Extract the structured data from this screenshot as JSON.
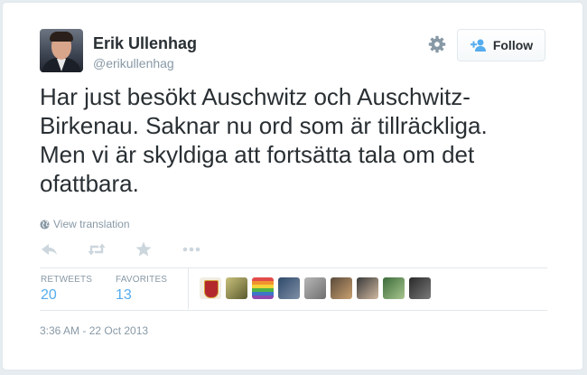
{
  "author": {
    "name": "Erik Ullenhag",
    "handle": "@erikullenhag"
  },
  "follow_button": {
    "label": "Follow"
  },
  "tweet": {
    "text": "Har just besökt Auschwitz och Auschwitz-\nBirkenau. Saknar nu ord som är tillräckliga.\nMen vi är skyldiga att fortsätta tala om det\nofattbara.",
    "translate_link": "View translation"
  },
  "stats": {
    "retweets_label": "RETWEETS",
    "retweets_value": "20",
    "favorites_label": "FAVORITES",
    "favorites_value": "13"
  },
  "timestamp": "3:36 AM - 22 Oct 2013",
  "colors": {
    "link_blue": "#55acee",
    "muted": "#8899a6",
    "text": "#292f33",
    "background": "#e6ecf0"
  },
  "icons": [
    "gear-icon",
    "add-user-icon",
    "globe-icon",
    "reply-icon",
    "retweet-icon",
    "favorite-icon",
    "more-icon"
  ]
}
